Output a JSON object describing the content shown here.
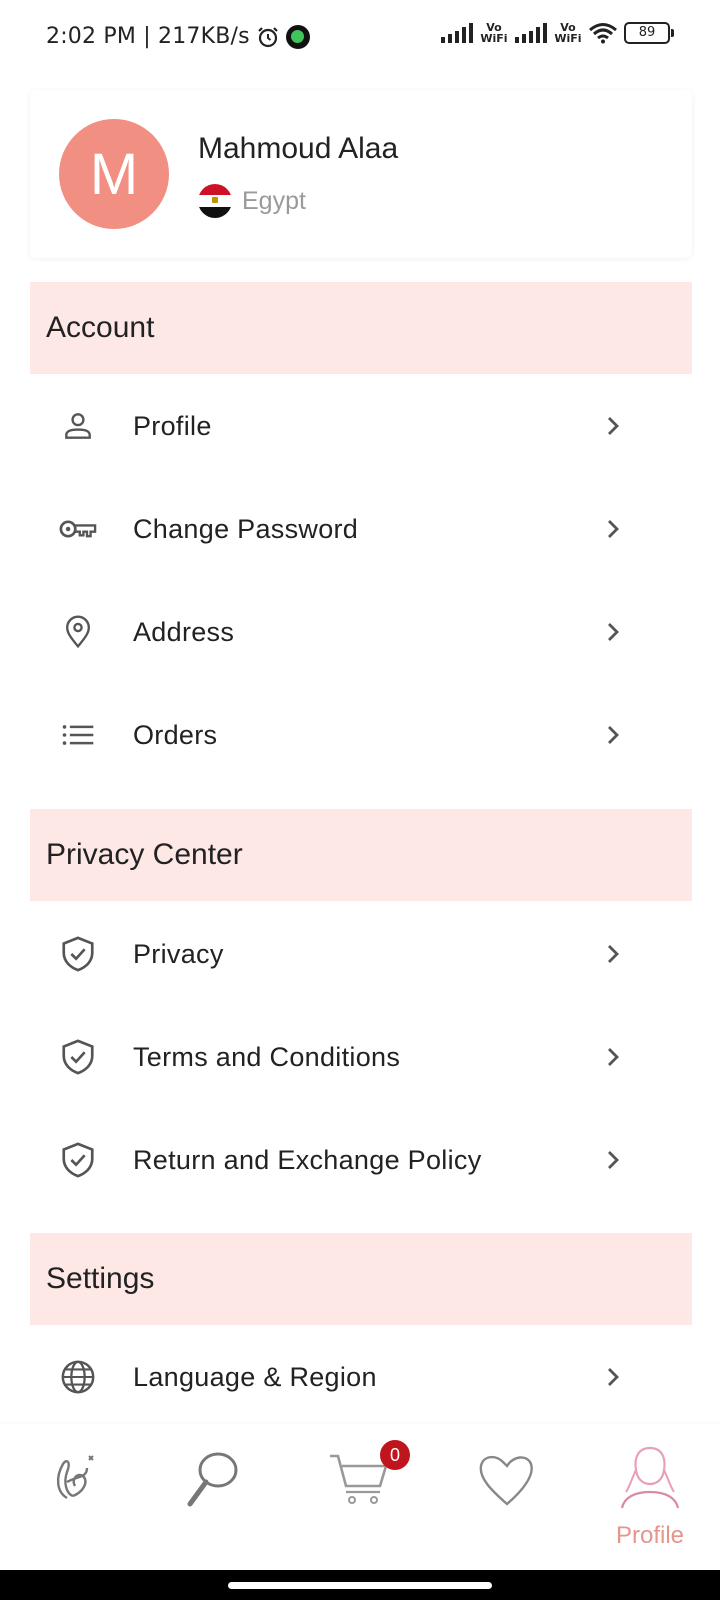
{
  "status_bar": {
    "time_speed": "2:02 PM | 217KB/s",
    "volte_1": "Vo\nWiFi",
    "volte_2": "Vo\nWiFi",
    "battery": "89"
  },
  "profile": {
    "avatar_letter": "M",
    "name": "Mahmoud Alaa",
    "country": "Egypt",
    "avatar_color": "#f08f82"
  },
  "sections": {
    "account": {
      "title": "Account",
      "items": [
        {
          "label": "Profile",
          "icon": "person-icon"
        },
        {
          "label": "Change Password",
          "icon": "key-icon"
        },
        {
          "label": "Address",
          "icon": "location-pin-icon"
        },
        {
          "label": "Orders",
          "icon": "list-icon"
        }
      ]
    },
    "privacy": {
      "title": "Privacy Center",
      "items": [
        {
          "label": "Privacy",
          "icon": "shield-check-icon"
        },
        {
          "label": "Terms and Conditions",
          "icon": "shield-check-icon"
        },
        {
          "label": "Return and Exchange Policy",
          "icon": "shield-check-icon"
        }
      ]
    },
    "settings": {
      "title": "Settings",
      "items": [
        {
          "label": "Language & Region",
          "icon": "globe-icon"
        }
      ]
    }
  },
  "bottom_nav": {
    "items": [
      {
        "icon": "home-logo-icon"
      },
      {
        "icon": "search-icon"
      },
      {
        "icon": "cart-icon"
      },
      {
        "icon": "heart-icon"
      },
      {
        "icon": "profile-icon",
        "label": "Profile",
        "active": true
      }
    ],
    "cart_count": "0"
  },
  "colors": {
    "section_bg": "#fde8e6",
    "accent": "#e6958a",
    "badge": "#c0151c"
  }
}
